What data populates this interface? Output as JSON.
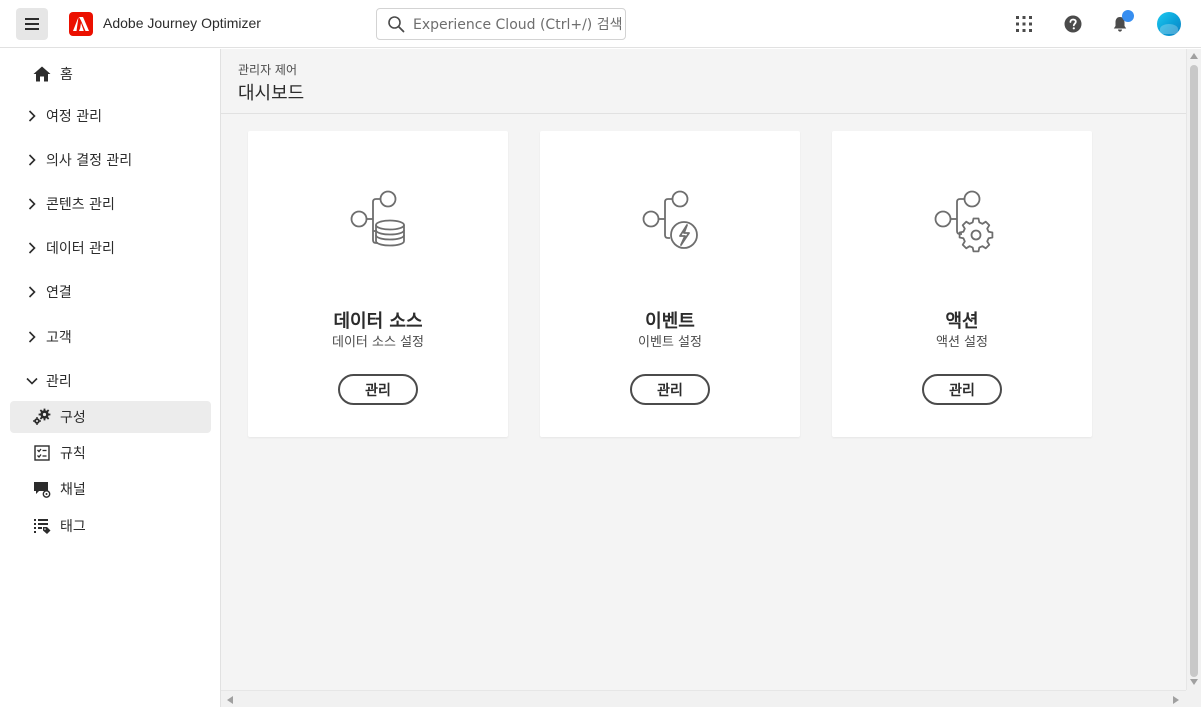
{
  "topbar": {
    "app_title": "Adobe Journey Optimizer",
    "search_placeholder": "Experience Cloud (Ctrl+/) 검색"
  },
  "sidebar": {
    "items": [
      {
        "label": "홈",
        "icon": "home-icon"
      },
      {
        "label": "여정 관리",
        "icon": "chevron-right-icon"
      },
      {
        "label": "의사 결정 관리",
        "icon": "chevron-right-icon"
      },
      {
        "label": "콘텐츠 관리",
        "icon": "chevron-right-icon"
      },
      {
        "label": "데이터 관리",
        "icon": "chevron-right-icon"
      },
      {
        "label": "연결",
        "icon": "chevron-right-icon"
      },
      {
        "label": "고객",
        "icon": "chevron-right-icon"
      },
      {
        "label": "관리",
        "icon": "chevron-down-icon"
      },
      {
        "label": "구성",
        "icon": "gears-icon"
      },
      {
        "label": "규칙",
        "icon": "rules-icon"
      },
      {
        "label": "채널",
        "icon": "channel-icon"
      },
      {
        "label": "태그",
        "icon": "tag-icon"
      }
    ]
  },
  "main": {
    "breadcrumb": "관리자 제어",
    "title": "대시보드",
    "cards": [
      {
        "title": "데이터 소스",
        "subtitle": "데이터 소스 설정",
        "button": "관리",
        "icon": "data-source-icon"
      },
      {
        "title": "이벤트",
        "subtitle": "이벤트 설정",
        "button": "관리",
        "icon": "event-icon"
      },
      {
        "title": "액션",
        "subtitle": "액션 설정",
        "button": "관리",
        "icon": "action-icon"
      }
    ]
  },
  "colors": {
    "adobe_red": "#eb1000",
    "notification": "#378ef0",
    "background": "#f4f4f4"
  }
}
